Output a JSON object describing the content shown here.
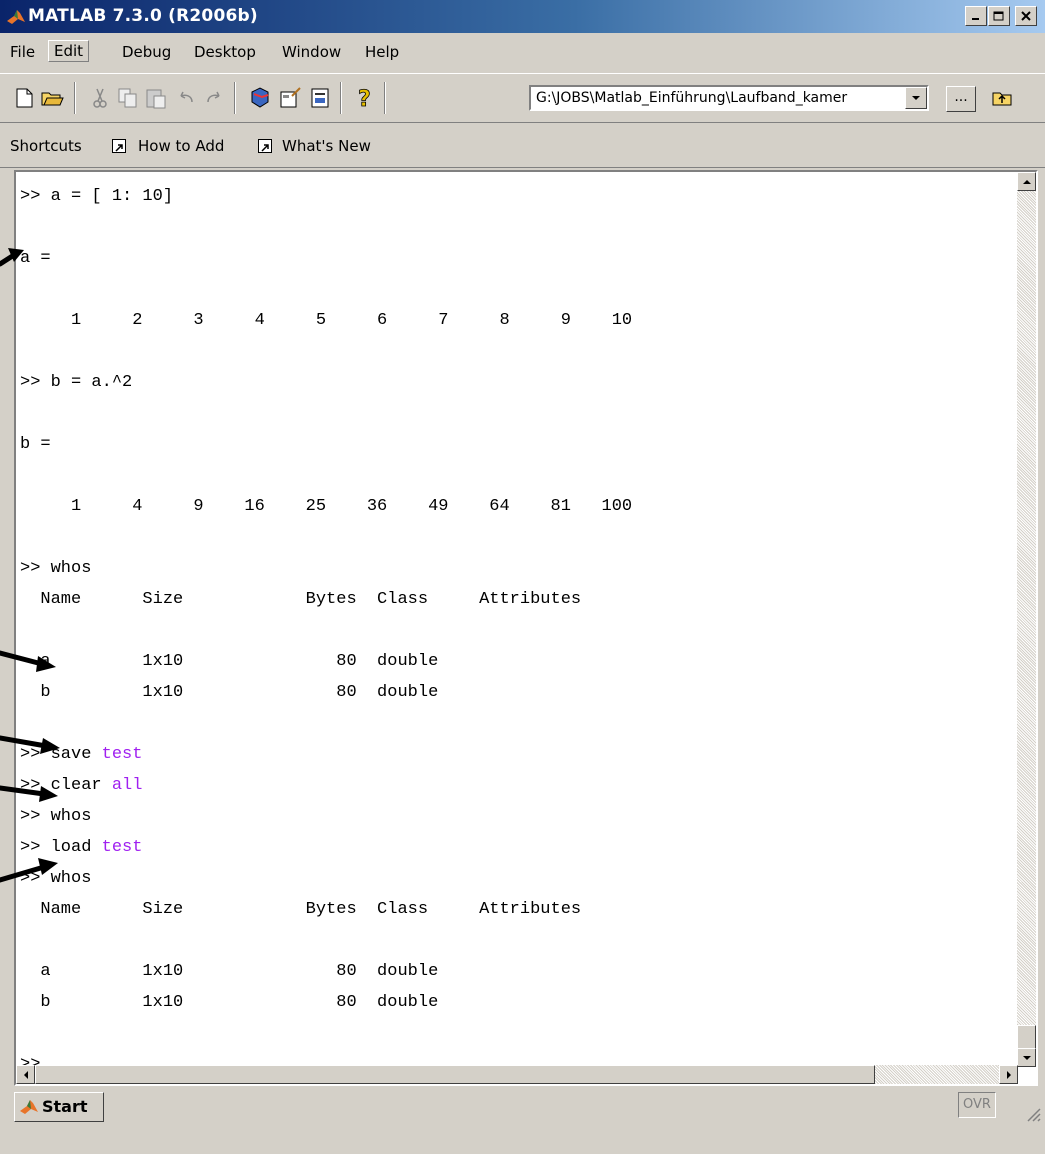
{
  "window": {
    "title": "MATLAB  7.3.0 (R2006b)",
    "controls": [
      "minimize",
      "maximize",
      "close"
    ]
  },
  "menu": {
    "items": [
      "File",
      "Edit",
      "Debug",
      "Desktop",
      "Window",
      "Help"
    ]
  },
  "toolbar": {
    "icons": [
      "new-file-icon",
      "open-folder-icon",
      "cut-icon",
      "copy-icon",
      "paste-icon",
      "undo-icon",
      "redo-icon",
      "simulink-icon",
      "guide-icon",
      "profiler-icon",
      "help-icon"
    ],
    "current_directory": "G:\\JOBS\\Matlab_Einführung\\Laufband_kamer",
    "browse_label": "..."
  },
  "shortcuts": {
    "label": "Shortcuts",
    "items": [
      "How to Add",
      "What's New"
    ]
  },
  "console": {
    "lines": [
      {
        "prompt": ">> ",
        "text": "a = [ 1: 10]"
      },
      {
        "text": "a ="
      },
      {
        "text": "     1     2     3     4     5     6     7     8     9    10"
      },
      {
        "prompt": ">> ",
        "text": "b = a.^2"
      },
      {
        "text": "b ="
      },
      {
        "text": "     1     4     9    16    25    36    49    64    81   100"
      },
      {
        "prompt": ">> ",
        "text": "whos"
      },
      {
        "text": "  Name      Size            Bytes  Class     Attributes"
      },
      {
        "text": "  a         1x10               80  double"
      },
      {
        "text": "  b         1x10               80  double"
      },
      {
        "prompt": ">> ",
        "cmd": "save ",
        "arg": "test"
      },
      {
        "prompt": ">> ",
        "cmd": "clear ",
        "arg": "all"
      },
      {
        "prompt": ">> ",
        "text": "whos"
      },
      {
        "prompt": ">> ",
        "cmd": "load ",
        "arg": "test"
      },
      {
        "prompt": ">> ",
        "text": "whos"
      },
      {
        "text": "  Name      Size            Bytes  Class     Attributes"
      },
      {
        "text": "  a         1x10               80  double"
      },
      {
        "text": "  b         1x10               80  double"
      },
      {
        "prompt": ">>",
        "text": ""
      }
    ]
  },
  "status": {
    "start_label": "Start",
    "mode": "OVR"
  },
  "colors": {
    "keyword": "#a020f0",
    "titlebar_start": "#0a246a",
    "titlebar_end": "#a6caf0",
    "face": "#d4d0c8"
  }
}
